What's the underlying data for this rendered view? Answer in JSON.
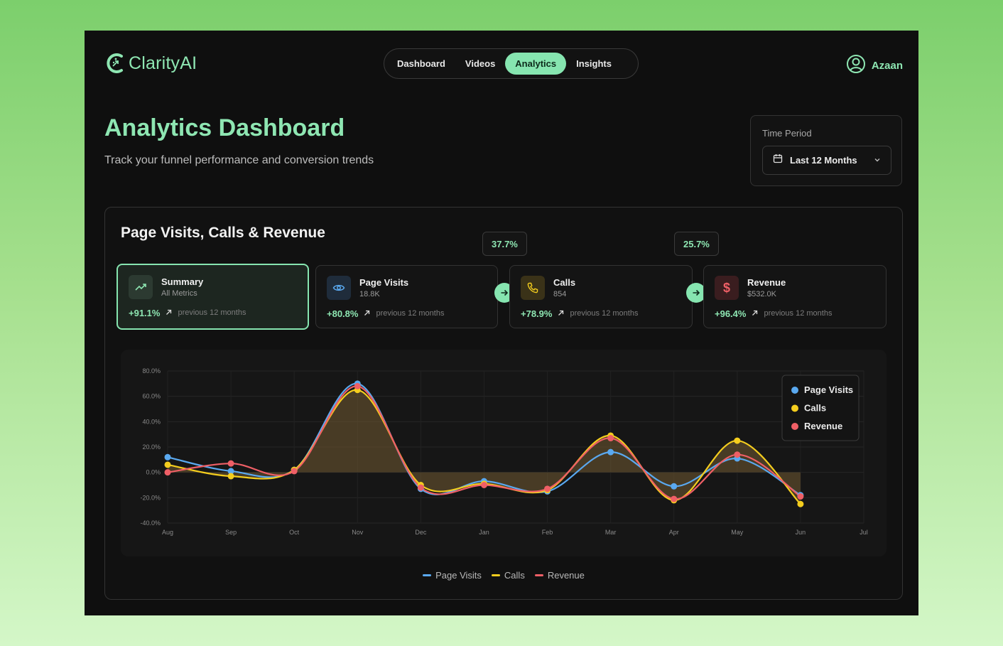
{
  "brand": {
    "name": "ClarityAI"
  },
  "nav": {
    "items": [
      {
        "label": "Dashboard",
        "active": false
      },
      {
        "label": "Videos",
        "active": false
      },
      {
        "label": "Analytics",
        "active": true
      },
      {
        "label": "Insights",
        "active": false
      }
    ]
  },
  "user": {
    "name": "Azaan"
  },
  "header": {
    "title": "Analytics Dashboard",
    "subtitle": "Track your funnel performance and conversion trends"
  },
  "time_period": {
    "label": "Time Period",
    "value": "Last 12 Months"
  },
  "card": {
    "title": "Page Visits, Calls & Revenue"
  },
  "conversions": [
    "37.7%",
    "25.7%"
  ],
  "metrics": [
    {
      "name": "Summary",
      "sub": "All Metrics",
      "change": "+91.1%",
      "prev": "previous 12 months",
      "icon": "trending-up-icon"
    },
    {
      "name": "Page Visits",
      "sub": "18.8K",
      "change": "+80.8%",
      "prev": "previous 12 months",
      "icon": "eye-icon"
    },
    {
      "name": "Calls",
      "sub": "854",
      "change": "+78.9%",
      "prev": "previous 12 months",
      "icon": "phone-icon"
    },
    {
      "name": "Revenue",
      "sub": "$532.0K",
      "change": "+96.4%",
      "prev": "previous 12 months",
      "icon": "dollar-icon"
    }
  ],
  "colors": {
    "accent": "#86e5b0",
    "page_visits": "#5aa9f0",
    "calls": "#f4cd1e",
    "revenue": "#ef5f66"
  },
  "chart_data": {
    "type": "line",
    "categories": [
      "Aug",
      "Sep",
      "Oct",
      "Nov",
      "Dec",
      "Jan",
      "Feb",
      "Mar",
      "Apr",
      "May",
      "Jun",
      "Jul"
    ],
    "y_ticks": [
      "80.0%",
      "60.0%",
      "40.0%",
      "20.0%",
      "0.0%",
      "-20.0%",
      "-40.0%"
    ],
    "ylim": [
      -40,
      80
    ],
    "series": [
      {
        "name": "Page Visits",
        "color": "#5aa9f0",
        "values": [
          12,
          1,
          2,
          70,
          -13,
          -7,
          -15,
          16,
          -11,
          11,
          -18
        ]
      },
      {
        "name": "Calls",
        "color": "#f4cd1e",
        "values": [
          6,
          -3,
          2,
          65,
          -10,
          -9,
          -14,
          29,
          -22,
          25,
          -25
        ]
      },
      {
        "name": "Revenue",
        "color": "#ef5f66",
        "values": [
          0,
          7,
          1,
          68,
          -12,
          -10,
          -13,
          27,
          -21,
          14,
          -19
        ]
      }
    ],
    "grid": true,
    "legend": "top-right"
  }
}
